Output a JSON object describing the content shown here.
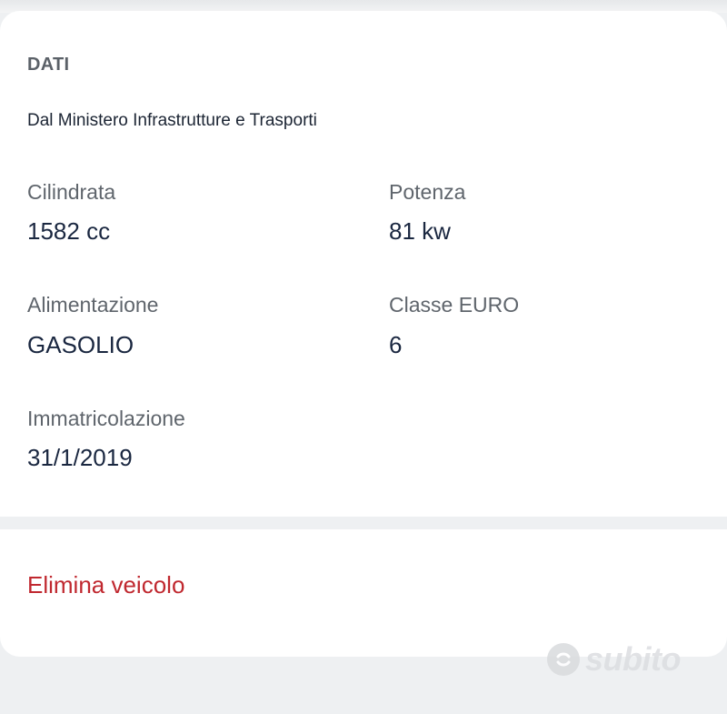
{
  "section": {
    "title": "DATI",
    "subtitle": "Dal Ministero Infrastrutture e Trasporti"
  },
  "fields": {
    "cilindrata": {
      "label": "Cilindrata",
      "value": "1582 cc"
    },
    "potenza": {
      "label": "Potenza",
      "value": "81 kw"
    },
    "alimentazione": {
      "label": "Alimentazione",
      "value": "GASOLIO"
    },
    "classe_euro": {
      "label": "Classe EURO",
      "value": "6"
    },
    "immatricolazione": {
      "label": "Immatricolazione",
      "value": "31/1/2019"
    }
  },
  "actions": {
    "delete_label": "Elimina veicolo"
  },
  "watermark": {
    "brand": "subito",
    "icon": "subito-logo-icon"
  },
  "colors": {
    "accent_red": "#c0282f",
    "value_text": "#1a2740",
    "label_text": "#5f656c"
  }
}
